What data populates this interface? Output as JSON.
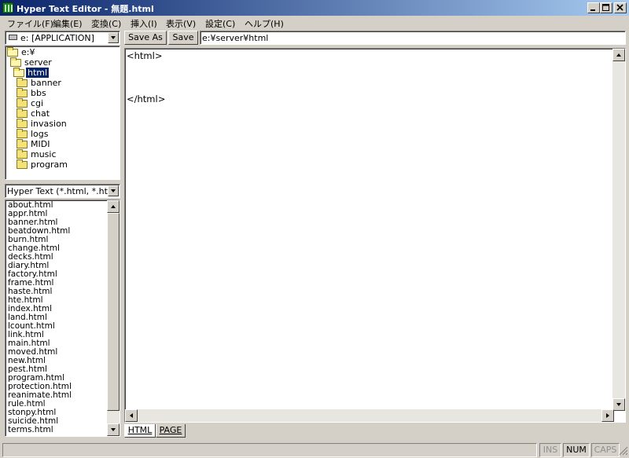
{
  "window": {
    "title": "Hyper Text Editor - 無題.html",
    "minimize_icon": "minimize-icon",
    "maximize_icon": "maximize-icon",
    "close_icon": "close-icon"
  },
  "menu": [
    "ファイル(F)",
    "編集(E)",
    "変換(C)",
    "挿入(I)",
    "表示(V)",
    "設定(C)",
    "ヘルプ(H)"
  ],
  "toolbar": {
    "drive": "e: [APPLICATION]",
    "save_as": "Save As",
    "save": "Save",
    "path": "e:¥server¥html"
  },
  "tree": [
    {
      "label": "e:¥",
      "state": "open",
      "level": 0
    },
    {
      "label": "server",
      "state": "open",
      "level": 1
    },
    {
      "label": "html",
      "state": "open",
      "level": 2,
      "selected": true
    },
    {
      "label": "banner",
      "state": "closed",
      "level": 3
    },
    {
      "label": "bbs",
      "state": "closed",
      "level": 3
    },
    {
      "label": "cgi",
      "state": "closed",
      "level": 3
    },
    {
      "label": "chat",
      "state": "closed",
      "level": 3
    },
    {
      "label": "invasion",
      "state": "closed",
      "level": 3
    },
    {
      "label": "logs",
      "state": "closed",
      "level": 3
    },
    {
      "label": "MIDI",
      "state": "closed",
      "level": 3
    },
    {
      "label": "music",
      "state": "closed",
      "level": 3
    },
    {
      "label": "program",
      "state": "closed",
      "level": 3
    }
  ],
  "filter": "Hyper Text (*.html, *.htm)",
  "files": [
    "about.html",
    "appr.html",
    "banner.html",
    "beatdown.html",
    "burn.html",
    "change.html",
    "decks.html",
    "diary.html",
    "factory.html",
    "frame.html",
    "haste.html",
    "hte.html",
    "index.html",
    "land.html",
    "lcount.html",
    "link.html",
    "main.html",
    "moved.html",
    "new.html",
    "pest.html",
    "program.html",
    "protection.html",
    "reanimate.html",
    "rule.html",
    "stonpy.html",
    "suicide.html",
    "terms.html"
  ],
  "editor": {
    "content": "<html>\n\n\n\n</html>"
  },
  "tabs": [
    "HTML",
    "PAGE"
  ],
  "status": {
    "ins": "INS",
    "num": "NUM",
    "caps": "CAPS"
  },
  "colors": {
    "titlebar_start": "#0a246a",
    "titlebar_end": "#a6caf0",
    "face": "#d4d0c8",
    "selection": "#0a246a"
  }
}
